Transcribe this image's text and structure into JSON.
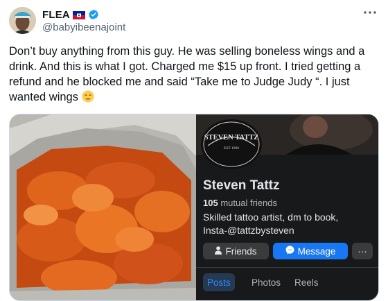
{
  "tweet": {
    "display_name": "FLEA",
    "handle": "@babyibeenajoint",
    "text": "Don’t buy anything from this guy. He was selling boneless wings and a drink. And this is what I got. Charged me $15 up front. I tried getting a refund and he blocked me and said “Take me to Judge Judy “. I just wanted wings",
    "emoji": "relieved-face-icon",
    "flag": "haiti-flag-icon",
    "verified_color": "#1d9bf0"
  },
  "facebook_profile": {
    "logo_text": "STEVEN TATTZ",
    "logo_subtext": "EST 1990",
    "name": "Steven Tattz",
    "mutual_count": "105",
    "mutual_label": "mutual friends",
    "bio_line1": "Skilled tattoo artist, dm to book,",
    "bio_line2": "Insta-@tattzbysteven",
    "buttons": {
      "friends": "Friends",
      "message": "Message",
      "more": "···"
    },
    "tabs": [
      "Posts",
      "Photos",
      "Reels"
    ],
    "colors": {
      "accent": "#1877f2",
      "background": "#18191a"
    }
  }
}
